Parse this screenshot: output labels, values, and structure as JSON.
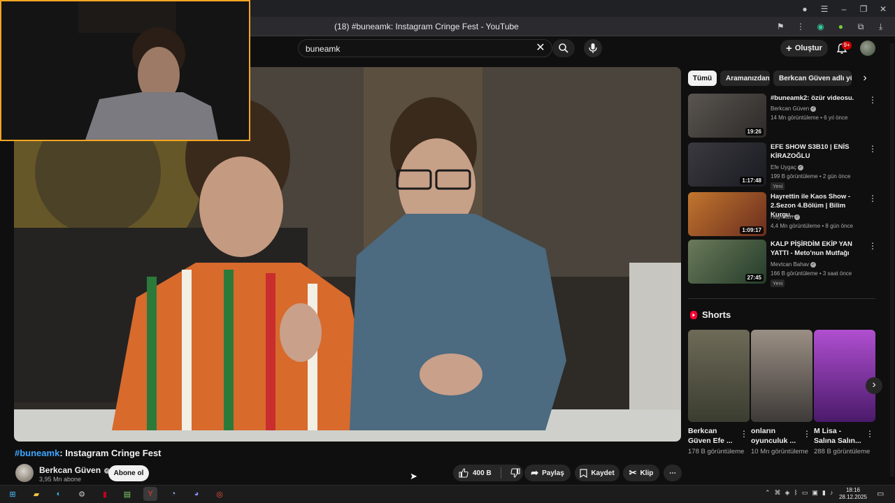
{
  "browser": {
    "page_title": "(18) #buneamk: Instagram Cringe Fest - YouTube"
  },
  "header": {
    "search_value": "buneamk",
    "create_label": "Oluştur",
    "notification_count": "9+"
  },
  "video": {
    "hashtag": "#buneamk",
    "title_rest": ": Instagram Cringe Fest",
    "channel_name": "Berkcan Güven",
    "subscribers": "3,95 Mn abone",
    "subscribe_label": "Abone ol",
    "like_count": "400 B",
    "share_label": "Paylaş",
    "save_label": "Kaydet",
    "clip_label": "Klip"
  },
  "sidebar": {
    "chips": [
      "Tümü",
      "Aramanızdan",
      "Berkcan Güven adlı yük"
    ],
    "recommendations": [
      {
        "title": "#buneamk2: özür videosu.",
        "channel": "Berkcan Güven",
        "meta": "14 Mn görüntüleme • 6 yıl önce",
        "duration": "19:26",
        "badge": "",
        "thumb_colors": [
          "#5a5550",
          "#2d2a28"
        ]
      },
      {
        "title": "EFE SHOW S3B10 | ENİS KİRAZOĞLU",
        "channel": "Efe Uygaç",
        "meta": "199 B görüntüleme • 2 gün önce",
        "duration": "1:17:48",
        "badge": "Yeni",
        "thumb_colors": [
          "#3b3a40",
          "#1a1a22"
        ]
      },
      {
        "title": "Hayrettin ile Kaos Show - 2.Sezon 4.Bölüm | Bilim Kurgu...",
        "channel": "Hayrettin",
        "meta": "4,4 Mn görüntüleme • 8 gün önce",
        "duration": "1:09:17",
        "badge": "",
        "thumb_colors": [
          "#c2762e",
          "#6a2d1e"
        ]
      },
      {
        "title": "KALP PİŞİRDİM EKİP YAN YATTI - Meto'nun Mutfağı",
        "channel": "Mevtcan Bahav",
        "meta": "166 B görüntüleme • 3 saat önce",
        "duration": "27:45",
        "badge": "Yeni",
        "thumb_colors": [
          "#6b7a5a",
          "#243c2a"
        ]
      }
    ],
    "shorts_heading": "Shorts",
    "shorts": [
      {
        "title": "Berkcan Güven Efe ...",
        "views": "178 B görüntüleme",
        "thumb_colors": [
          "#6e6a58",
          "#3a3d30"
        ]
      },
      {
        "title": "onların oyunculuk ...",
        "views": "10 Mn görüntüleme",
        "thumb_colors": [
          "#9a8f84",
          "#3e3a38"
        ]
      },
      {
        "title": "M Lisa - Salına Salın...",
        "views": "288 B görüntüleme",
        "thumb_colors": [
          "#b04fd0",
          "#4a1a6a"
        ]
      }
    ]
  },
  "taskbar": {
    "time": "18:16",
    "date": "28.12.2025"
  }
}
